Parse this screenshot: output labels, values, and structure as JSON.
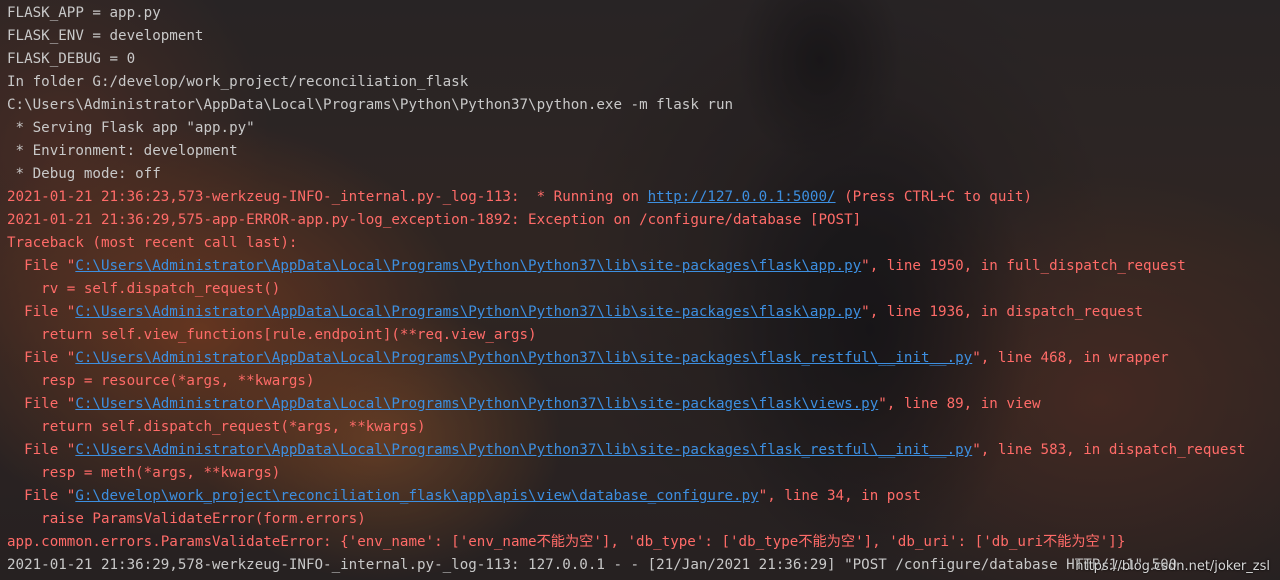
{
  "console": {
    "env_lines": [
      "FLASK_APP = app.py",
      "FLASK_ENV = development",
      "FLASK_DEBUG = 0",
      "In folder G:/develop/work_project/reconciliation_flask",
      "C:\\Users\\Administrator\\AppData\\Local\\Programs\\Python\\Python37\\python.exe -m flask run",
      " * Serving Flask app \"app.py\"",
      " * Environment: development",
      " * Debug mode: off"
    ],
    "running": {
      "prefix": "2021-01-21 21:36:23,573-werkzeug-INFO-_internal.py-_log-113:  * Running on ",
      "url": "http://127.0.0.1:5000/",
      "suffix": " (Press CTRL+C to quit)"
    },
    "error_line": "2021-01-21 21:36:29,575-app-ERROR-app.py-log_exception-1892: Exception on /configure/database [POST]",
    "traceback_header": "Traceback (most recent call last):",
    "frames": [
      {
        "file": "C:\\Users\\Administrator\\AppData\\Local\\Programs\\Python\\Python37\\lib\\site-packages\\flask\\app.py",
        "location": "\", line 1950, in full_dispatch_request",
        "code": "    rv = self.dispatch_request()"
      },
      {
        "file": "C:\\Users\\Administrator\\AppData\\Local\\Programs\\Python\\Python37\\lib\\site-packages\\flask\\app.py",
        "location": "\", line 1936, in dispatch_request",
        "code": "    return self.view_functions[rule.endpoint](**req.view_args)"
      },
      {
        "file": "C:\\Users\\Administrator\\AppData\\Local\\Programs\\Python\\Python37\\lib\\site-packages\\flask_restful\\__init__.py",
        "location": "\", line 468, in wrapper",
        "code": "    resp = resource(*args, **kwargs)"
      },
      {
        "file": "C:\\Users\\Administrator\\AppData\\Local\\Programs\\Python\\Python37\\lib\\site-packages\\flask\\views.py",
        "location": "\", line 89, in view",
        "code": "    return self.dispatch_request(*args, **kwargs)"
      },
      {
        "file": "C:\\Users\\Administrator\\AppData\\Local\\Programs\\Python\\Python37\\lib\\site-packages\\flask_restful\\__init__.py",
        "location": "\", line 583, in dispatch_request",
        "code": "    resp = meth(*args, **kwargs)"
      },
      {
        "file": "G:\\develop\\work_project\\reconciliation_flask\\app\\apis\\view\\database_configure.py",
        "location": "\", line 34, in post",
        "code": "    raise ParamsValidateError(form.errors)"
      }
    ],
    "frame_prefix": "  File \"",
    "exception_line": "app.common.errors.ParamsValidateError: {'env_name': ['env_name不能为空'], 'db_type': ['db_type不能为空'], 'db_uri': ['db_uri不能为空']}",
    "last_line_prefix": "2021-01-21 21:36:29,578-werkzeug-INFO-_internal.py-_log-113: 127.0.0.1 - - [21/Jan/2021 21:36:29] ",
    "last_line_request": "\"POST /configure/database HTTP/1.1\" 500"
  },
  "watermark": "https://blog.csdn.net/joker_zsl",
  "colors": {
    "plain_text": "#c8c8c8",
    "error_text": "#ff6b68",
    "link_text": "#3d8fe0"
  }
}
